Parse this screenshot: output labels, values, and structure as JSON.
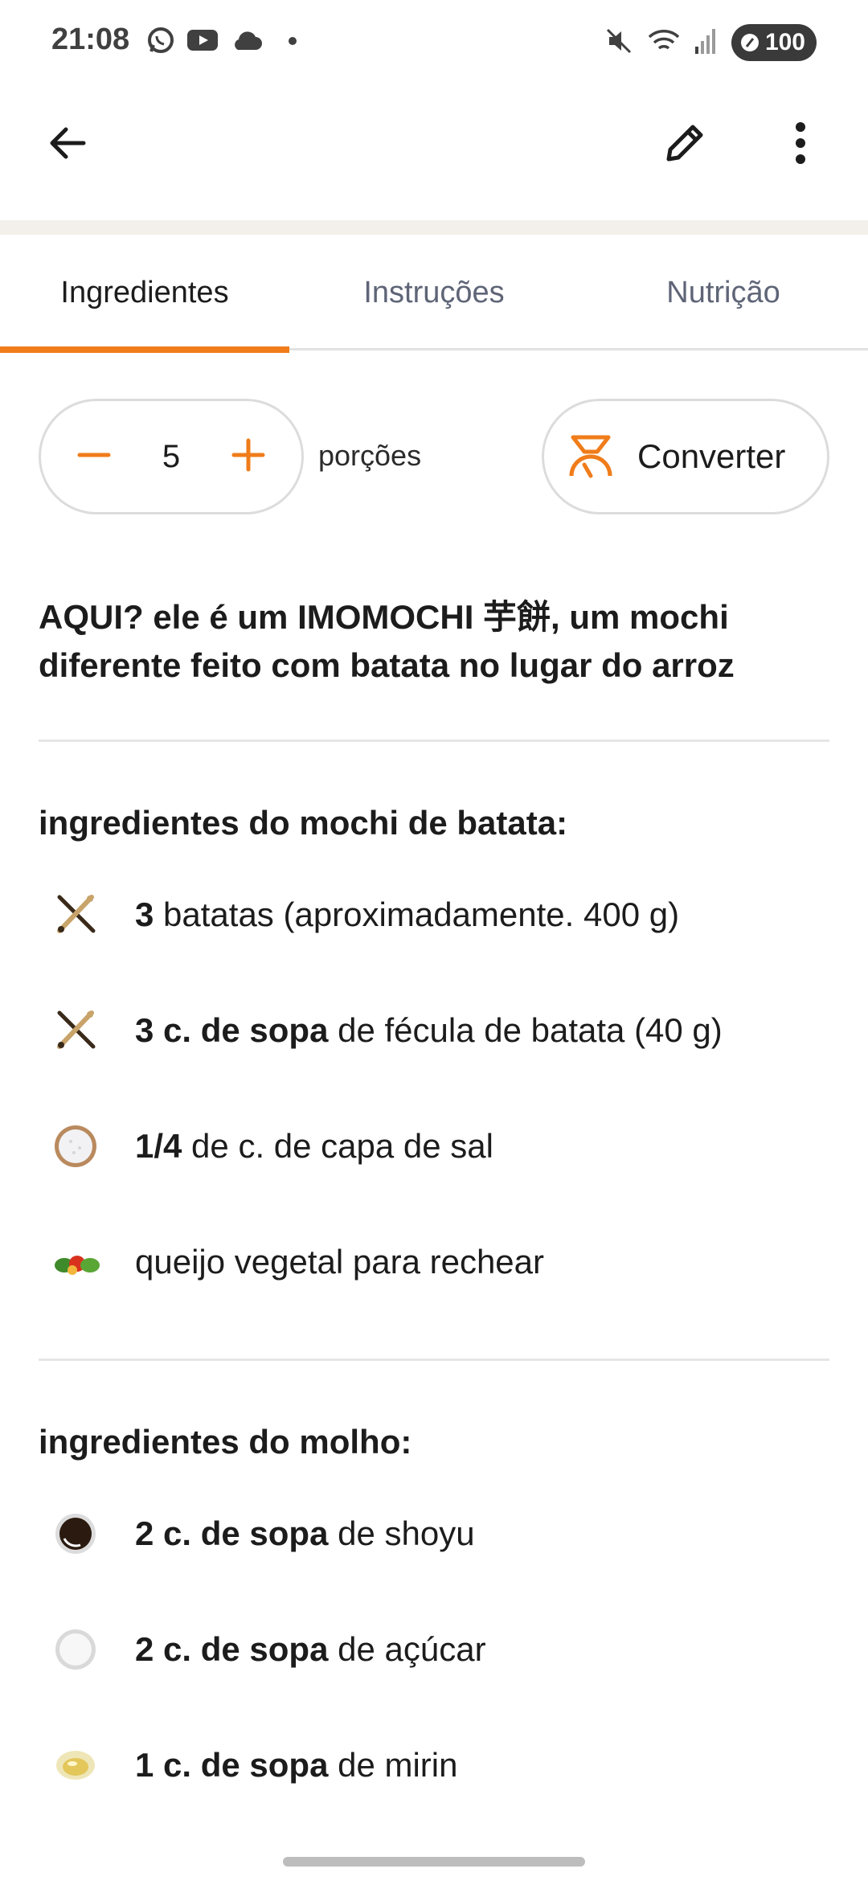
{
  "status_bar": {
    "time": "21:08",
    "battery": "100",
    "left_icons": [
      "whatsapp-icon",
      "youtube-icon",
      "cloud-icon",
      "dot-icon"
    ],
    "right_icons": [
      "mute-icon",
      "wifi-icon",
      "signal-icon",
      "battery-icon"
    ]
  },
  "app_bar": {
    "back_icon": "arrow-left-icon",
    "edit_icon": "pencil-icon",
    "more_icon": "more-vertical-icon"
  },
  "tabs": [
    {
      "label": "Ingredientes",
      "active": true
    },
    {
      "label": "Instruções",
      "active": false
    },
    {
      "label": "Nutrição",
      "active": false
    }
  ],
  "servings": {
    "value": "5",
    "label": "porções"
  },
  "convert": {
    "label": "Converter"
  },
  "accent_color": "#f07c1a",
  "description": "AQUI? ele é um IMOMOCHI 芋餅, um mochi diferente feito com batata no lugar do arroz",
  "sections": [
    {
      "title": "ingredientes do mochi de batata:",
      "items": [
        {
          "qty": "3",
          "text": " batatas (aproximadamente. 400 g)",
          "icon": "utensils-icon"
        },
        {
          "qty": "3 c. de sopa",
          "text": " de fécula de batata (40 g)",
          "icon": "utensils-icon"
        },
        {
          "qty": "1/4",
          "text": " de c. de capa de sal",
          "icon": "salt-icon"
        },
        {
          "qty": "",
          "text": "queijo vegetal para rechear",
          "icon": "vegetables-icon"
        }
      ]
    },
    {
      "title": "ingredientes do molho:",
      "items": [
        {
          "qty": "2 c. de sopa",
          "text": " de shoyu",
          "icon": "soy-sauce-icon"
        },
        {
          "qty": "2 c. de sopa",
          "text": " de açúcar",
          "icon": "sugar-icon"
        },
        {
          "qty": "1 c. de sopa",
          "text": " de mirin",
          "icon": "mirin-icon"
        }
      ]
    }
  ]
}
